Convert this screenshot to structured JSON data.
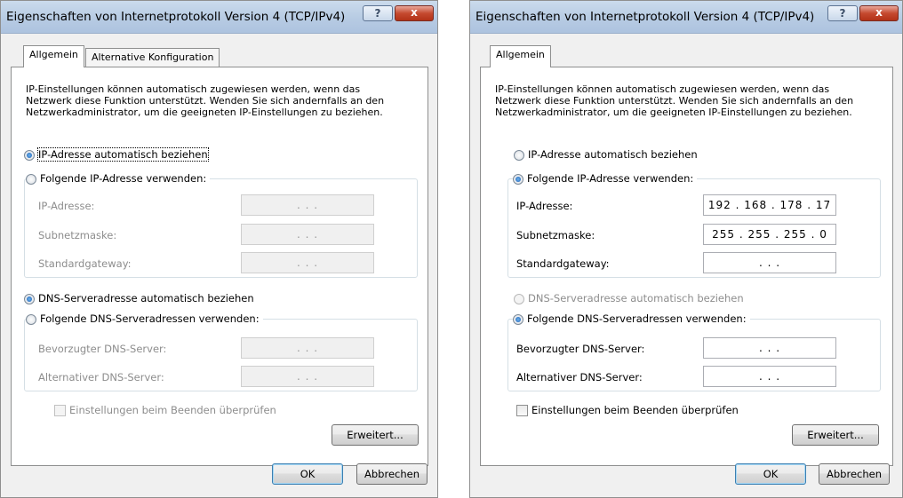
{
  "dialogs": [
    {
      "title": "Eigenschaften von Internetprotokoll Version 4 (TCP/IPv4)",
      "help_label": "?",
      "close_label": "x",
      "tabs": [
        "Allgemein",
        "Alternative Konfiguration"
      ],
      "intro": "IP-Einstellungen können automatisch zugewiesen werden, wenn das Netzwerk diese Funktion unterstützt. Wenden Sie sich andernfalls an den Netzwerkadministrator, um die geeigneten IP-Einstellungen zu beziehen.",
      "radio_ip_auto": "IP-Adresse automatisch beziehen",
      "radio_ip_manual": "Folgende IP-Adresse verwenden:",
      "ip_mode": "auto",
      "fields_ip": [
        {
          "label": "IP-Adresse:",
          "value": ". . ."
        },
        {
          "label": "Subnetzmaske:",
          "value": ". . ."
        },
        {
          "label": "Standardgateway:",
          "value": ". . ."
        }
      ],
      "radio_dns_auto": "DNS-Serveradresse automatisch beziehen",
      "radio_dns_manual": "Folgende DNS-Serveradressen verwenden:",
      "dns_mode": "auto",
      "fields_dns": [
        {
          "label": "Bevorzugter DNS-Server:",
          "value": ". . ."
        },
        {
          "label": "Alternativer DNS-Server:",
          "value": ". . ."
        }
      ],
      "checkbox_label": "Einstellungen beim Beenden überprüfen",
      "advanced_label": "Erweitert...",
      "ok_label": "OK",
      "cancel_label": "Abbrechen"
    },
    {
      "title": "Eigenschaften von Internetprotokoll Version 4 (TCP/IPv4)",
      "help_label": "?",
      "close_label": "x",
      "tabs": [
        "Allgemein"
      ],
      "intro": "IP-Einstellungen können automatisch zugewiesen werden, wenn das Netzwerk diese Funktion unterstützt. Wenden Sie sich andernfalls an den Netzwerkadministrator, um die geeigneten IP-Einstellungen zu beziehen.",
      "radio_ip_auto": "IP-Adresse automatisch beziehen",
      "radio_ip_manual": "Folgende IP-Adresse verwenden:",
      "ip_mode": "manual",
      "fields_ip": [
        {
          "label": "IP-Adresse:",
          "value": "192 . 168 . 178 . 17"
        },
        {
          "label": "Subnetzmaske:",
          "value": "255 . 255 . 255 . 0"
        },
        {
          "label": "Standardgateway:",
          "value": ". . ."
        }
      ],
      "radio_dns_auto": "DNS-Serveradresse automatisch beziehen",
      "radio_dns_manual": "Folgende DNS-Serveradressen verwenden:",
      "dns_mode": "manual",
      "fields_dns": [
        {
          "label": "Bevorzugter DNS-Server:",
          "value": ". . ."
        },
        {
          "label": "Alternativer DNS-Server:",
          "value": ". . ."
        }
      ],
      "checkbox_label": "Einstellungen beim Beenden überprüfen",
      "advanced_label": "Erweitert...",
      "ok_label": "OK",
      "cancel_label": "Abbrechen"
    }
  ]
}
